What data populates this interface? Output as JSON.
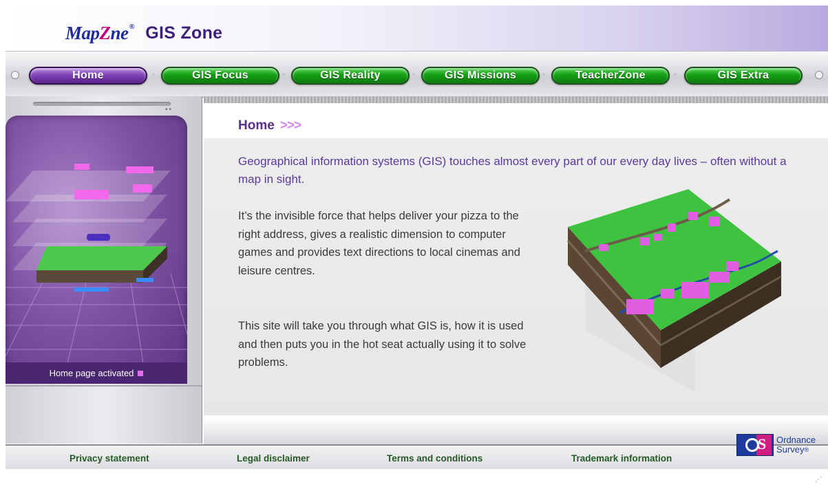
{
  "header": {
    "logo": {
      "brand_map": "Map",
      "brand_z": "Z",
      "brand_ne": "ne",
      "reg": "®",
      "title": "GIS Zone"
    }
  },
  "nav": {
    "items": [
      {
        "label": "Home",
        "active": true
      },
      {
        "label": "GIS Focus",
        "active": false
      },
      {
        "label": "GIS Reality",
        "active": false
      },
      {
        "label": "GIS Missions",
        "active": false
      },
      {
        "label": "TeacherZone",
        "active": false
      },
      {
        "label": "GIS Extra",
        "active": false
      }
    ]
  },
  "left_panel": {
    "caption": "Home page activated"
  },
  "main": {
    "title": "Home",
    "title_arrows": ">>>",
    "intro": "Geographical information systems (GIS) touches almost every part of our every day lives – often without a map in sight.",
    "para1": "It’s the invisible force that helps deliver your pizza to the right address, gives a realistic dimension to computer games and provides text directions to local cinemas and leisure centres.",
    "para2": "This site will take you through what GIS is, how it is used and then puts you in the hot seat actually using it to solve problems."
  },
  "footer": {
    "links": [
      {
        "label": "Privacy statement"
      },
      {
        "label": "Legal disclaimer"
      },
      {
        "label": "Terms and conditions"
      },
      {
        "label": "Trademark information"
      }
    ],
    "os_logo": {
      "line1": "Ordnance",
      "line2": "Survey",
      "reg": "®"
    }
  },
  "colors": {
    "nav_green": "#16a016",
    "nav_active_purple": "#7b3fb3",
    "title_purple": "#5a2f8a",
    "intro_purple": "#5b3a9a",
    "footer_link_green": "#245b24",
    "os_blue": "#1d3b9c",
    "os_pink": "#d01d83"
  }
}
